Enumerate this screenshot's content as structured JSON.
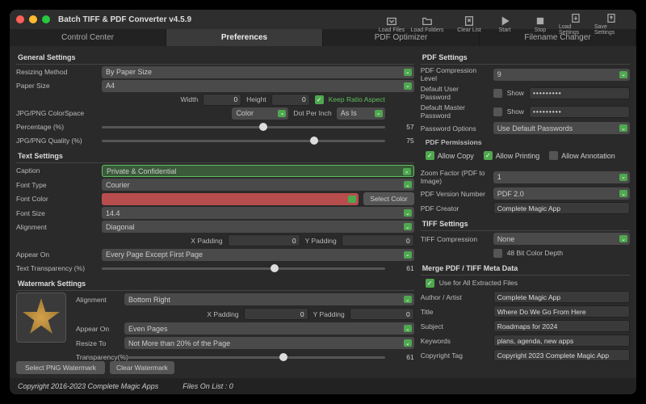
{
  "title": "Batch TIFF & PDF Converter v4.5.9",
  "toolbar": [
    {
      "name": "load-files",
      "label": "Load Files"
    },
    {
      "name": "load-folders",
      "label": "Load Folders"
    },
    {
      "name": "clear-list",
      "label": "Clear List"
    },
    {
      "name": "start",
      "label": "Start"
    },
    {
      "name": "stop",
      "label": "Stop"
    },
    {
      "name": "load-settings",
      "label": "Load Settings"
    },
    {
      "name": "save-settings",
      "label": "Save Settings"
    }
  ],
  "tabs": [
    "Control Center",
    "Preferences",
    "PDF Optimizer",
    "Filename Changer"
  ],
  "active_tab": "Preferences",
  "general": {
    "header": "General Settings",
    "resizing_method_label": "Resizing Method",
    "resizing_method": "By Paper Size",
    "paper_size_label": "Paper Size",
    "paper_size": "A4",
    "width_label": "Width",
    "width": "0",
    "height_label": "Height",
    "height": "0",
    "keep_ratio_label": "Keep Ratio Aspect",
    "keep_ratio": true,
    "colorspace_label": "JPG/PNG ColorSpace",
    "colorspace": "Color",
    "dpi_label": "Dot Per Inch",
    "dpi": "As Is",
    "percentage_label": "Percentage (%)",
    "percentage": 57,
    "quality_label": "JPG/PNG Quality (%)",
    "quality": 75
  },
  "text": {
    "header": "Text Settings",
    "caption_label": "Caption",
    "caption": "Private & Confidential",
    "font_type_label": "Font Type",
    "font_type": "Courier",
    "font_color_label": "Font Color",
    "select_color": "Select Color",
    "font_size_label": "Font Size",
    "font_size": "14.4",
    "alignment_label": "Alignment",
    "alignment": "Diagonal",
    "xpad_label": "X Padding",
    "xpad": "0",
    "ypad_label": "Y Padding",
    "ypad": "0",
    "appear_on_label": "Appear On",
    "appear_on": "Every Page Except First Page",
    "transparency_label": "Text Transparency (%)",
    "transparency": 61
  },
  "watermark": {
    "header": "Watermark Settings",
    "alignment_label": "Alignment",
    "alignment": "Bottom Right",
    "xpad_label": "X Padding",
    "xpad": "0",
    "ypad_label": "Y Padding",
    "ypad": "0",
    "appear_on_label": "Appear On",
    "appear_on": "Even Pages",
    "resize_label": "Resize To",
    "resize": "Not More than 20% of the Page",
    "transparency_label": "Transparency(%)",
    "transparency": 61,
    "select_png": "Select PNG Watermark",
    "clear": "Clear Watermark"
  },
  "pdf": {
    "header": "PDF Settings",
    "compression_label": "PDF Compression Level",
    "compression": "9",
    "user_pw_label": "Default User Password",
    "show": "Show",
    "user_pw": "•••••••••",
    "master_pw_label": "Default Master Password",
    "master_pw": "•••••••••",
    "pw_options_label": "Password Options",
    "pw_options": "Use Default Passwords",
    "permissions_header": "PDF Permissions",
    "allow_copy": "Allow Copy",
    "allow_printing": "Allow Printing",
    "allow_annotation": "Allow Annotation",
    "zoom_label": "Zoom Factor (PDF to Image)",
    "zoom": "1",
    "version_label": "PDF Version Number",
    "version": "PDF 2.0",
    "creator_label": "PDF Creator",
    "creator": "Complete Magic App"
  },
  "tiff": {
    "header": "TIFF Settings",
    "compression_label": "TIFF Compression",
    "compression": "None",
    "depth_label": "48 Bit Color Depth"
  },
  "meta": {
    "header": "Merge PDF / TIFF Meta Data",
    "use_all_label": "Use for All Extracted Files",
    "author_label": "Author / Artist",
    "author": "Complete Magic App",
    "title_label": "Title",
    "title_val": "Where Do We Go From Here",
    "subject_label": "Subject",
    "subject": "Roadmaps for 2024",
    "keywords_label": "Keywords",
    "keywords": "plans, agenda, new apps",
    "copyright_label": "Copyright Tag",
    "copyright": "Copyright 2023 Complete Magic App"
  },
  "footer": {
    "copyright": "Copyright 2016-2023 Complete Magic Apps",
    "files_label": "Files On List :",
    "files": "0"
  }
}
